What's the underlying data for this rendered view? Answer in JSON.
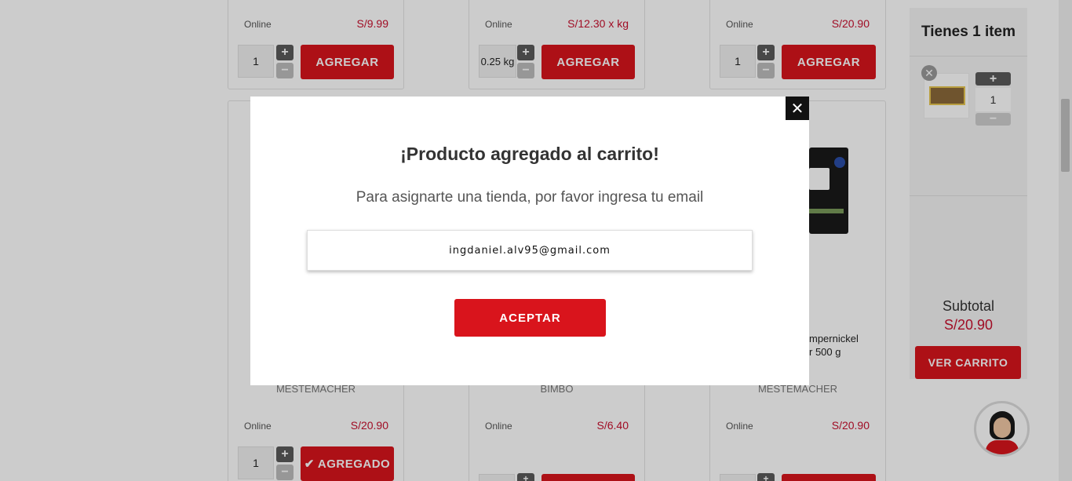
{
  "products_top": [
    {
      "availability": "Online",
      "price": "S/9.99",
      "qty": "1",
      "button": "AGREGAR"
    },
    {
      "availability": "Online",
      "price": "S/12.30 x kg",
      "qty": "0.25 kg",
      "button": "AGREGAR"
    },
    {
      "availability": "Online",
      "price": "S/20.90",
      "qty": "1",
      "button": "AGREGAR"
    }
  ],
  "products_bottom": [
    {
      "brand": "MESTEMACHER",
      "availability": "Online",
      "price": "S/20.90",
      "qty": "1",
      "button": "AGREGADO"
    },
    {
      "brand": "BIMBO",
      "availability": "Online",
      "price": "S/6.40"
    },
    {
      "brand": "MESTEMACHER",
      "availability": "Online",
      "price": "S/20.90",
      "name_line1": "mpernickel",
      "name_line2": "r 500 g"
    }
  ],
  "cart": {
    "title": "Tienes 1 item",
    "item_qty": "1",
    "subtotal_label": "Subtotal",
    "subtotal_value": "S/20.90",
    "view_button": "VER CARRITO"
  },
  "modal": {
    "title": "¡Producto agregado al carrito!",
    "subtitle": "Para asignarte una tienda, por favor ingresa tu email",
    "email_value": "ingdaniel.alv95@gmail.com",
    "accept_button": "ACEPTAR",
    "close_icon": "close-icon"
  },
  "colors": {
    "accent": "#d9141c",
    "price": "#c8102e"
  }
}
